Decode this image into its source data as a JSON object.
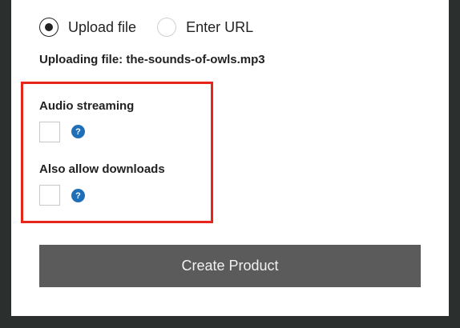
{
  "source_options": [
    {
      "label": "Upload file",
      "selected": true
    },
    {
      "label": "Enter URL",
      "selected": false
    }
  ],
  "upload_status": "Uploading file: the-sounds-of-owls.mp3",
  "options": {
    "audio_streaming": {
      "label": "Audio streaming",
      "checked": false,
      "help_glyph": "?"
    },
    "allow_downloads": {
      "label": "Also allow downloads",
      "checked": false,
      "help_glyph": "?"
    }
  },
  "highlight_color": "#e8251b",
  "help_icon_color": "#1f6fb8",
  "submit": {
    "label": "Create Product",
    "color": "#5b5b5b"
  }
}
